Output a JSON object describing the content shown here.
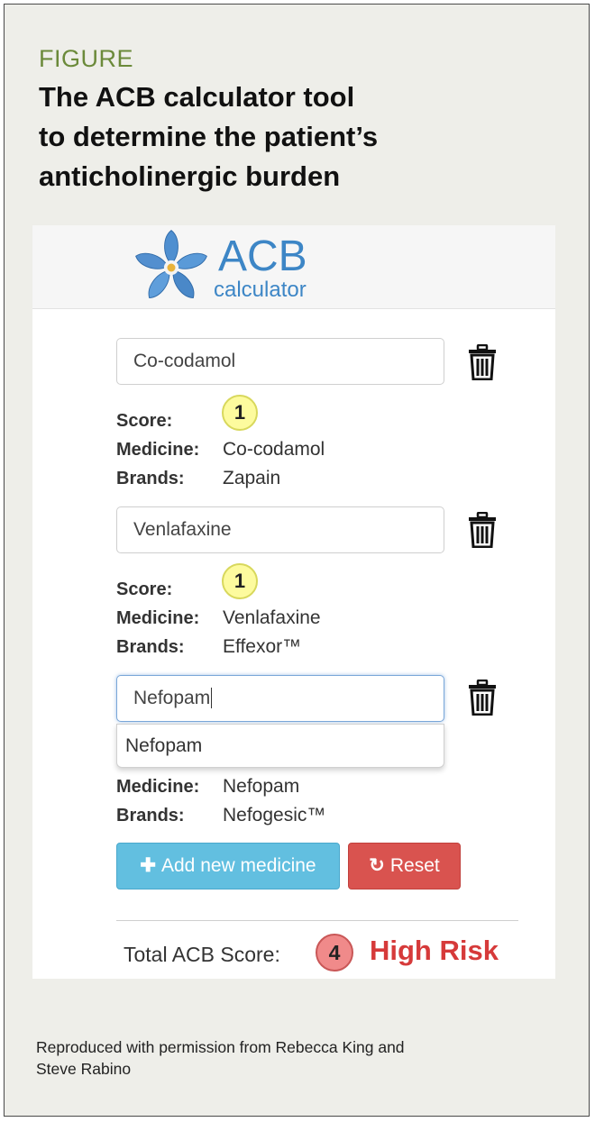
{
  "figure": {
    "label": "FIGURE",
    "title_lines": [
      "The ACB calculator tool",
      "to determine the patient’s",
      "anticholinergic burden"
    ],
    "caption_lines": [
      "Reproduced with permission from Rebecca King and",
      "Steve Rabino"
    ]
  },
  "app": {
    "logo_word": "ACB",
    "logo_sub": "calculator",
    "brand_color": "#3d86c6"
  },
  "labels": {
    "score": "Score:",
    "medicine": "Medicine:",
    "brands": "Brands:"
  },
  "medicines": [
    {
      "input_value": "Co-codamol",
      "score": "1",
      "medicine": "Co-codamol",
      "brands": "Zapain"
    },
    {
      "input_value": "Venlafaxine",
      "score": "1",
      "medicine": "Venlafaxine",
      "brands": "Effexor™"
    },
    {
      "input_value": "Nefopam",
      "medicine": "Nefopam",
      "brands": "Nefogesic™",
      "suggestion": "Nefopam"
    }
  ],
  "buttons": {
    "add": "Add new medicine",
    "reset": "Reset",
    "add_color": "#62bfe0",
    "reset_color": "#d9534f"
  },
  "total": {
    "label": "Total ACB Score:",
    "score": "4",
    "risk": "High Risk",
    "risk_color": "#d63a3a"
  }
}
